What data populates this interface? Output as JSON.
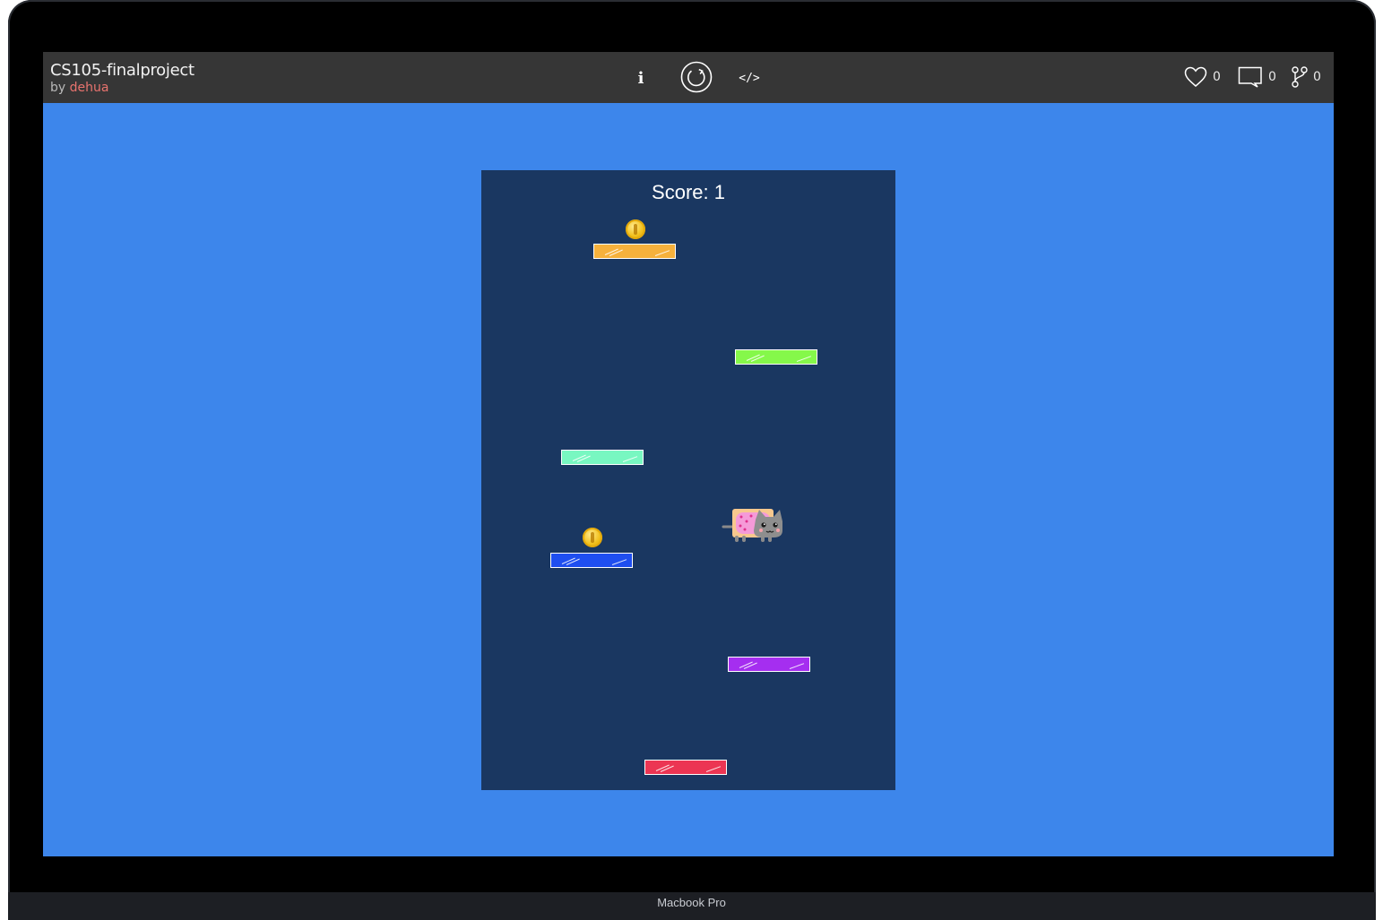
{
  "project": {
    "title": "CS105-finalproject",
    "by_prefix": "by",
    "author": "dehua"
  },
  "toolbar": {
    "info_label": "i",
    "code_label": "</>"
  },
  "stats": {
    "likes": "0",
    "comments": "0",
    "forks": "0"
  },
  "game": {
    "score_text": "Score: 1",
    "platform_colors": [
      "#f6b13c",
      "#85f84a",
      "#78f7c1",
      "#1f4ef0",
      "#a52ef0",
      "#ec3553"
    ],
    "coins": 2
  },
  "device": {
    "label": "Macbook Pro"
  },
  "colors": {
    "page_bg": "#3d86eb",
    "game_bg": "#1a3761",
    "topbar_bg": "#363636",
    "author": "#e8736e"
  }
}
